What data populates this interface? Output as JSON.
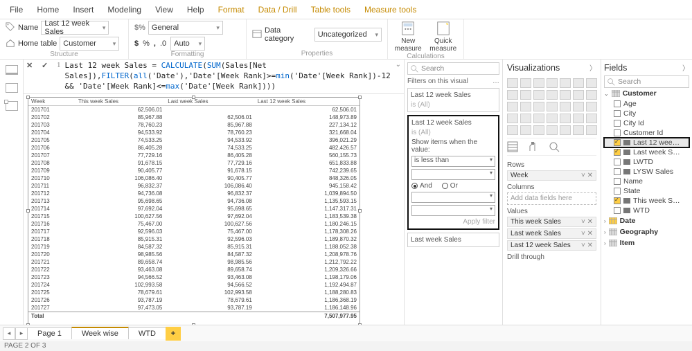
{
  "menu": [
    "File",
    "Home",
    "Insert",
    "Modeling",
    "View",
    "Help",
    "Format",
    "Data / Drill",
    "Table tools",
    "Measure tools"
  ],
  "menu_orange_from": 6,
  "ribbon": {
    "structure": {
      "name_label": "Name",
      "name_value": "Last 12 week Sales",
      "home_label": "Home table",
      "home_value": "Customer",
      "group": "Structure"
    },
    "formatting": {
      "currency": "$",
      "format_value": "General",
      "auto": "Auto",
      "group": "Formatting"
    },
    "properties": {
      "cat_label": "Data category",
      "cat_value": "Uncategorized",
      "group": "Properties"
    },
    "calc": {
      "new": "New measure",
      "quick": "Quick measure",
      "group": "Calculations"
    }
  },
  "formula": {
    "line_no": "1",
    "text": "Last 12 week Sales = CALCULATE(SUM(Sales[Net Sales]),FILTER(all('Date'),'Date'[Week Rank]>=min('Date'[Week Rank])-12 && 'Date'[Week Rank]<=max('Date'[Week Rank])))"
  },
  "table": {
    "headers": [
      "Week",
      "This week Sales",
      "Last week Sales",
      "Last 12 week Sales"
    ],
    "rows": [
      [
        "201701",
        "62,506.01",
        "",
        "62,506.01"
      ],
      [
        "201702",
        "85,967.88",
        "62,506.01",
        "148,973.89"
      ],
      [
        "201703",
        "78,760.23",
        "85,967.88",
        "227,134.12"
      ],
      [
        "201704",
        "94,533.92",
        "78,760.23",
        "321,668.04"
      ],
      [
        "201705",
        "74,533.25",
        "94,533.92",
        "396,021.29"
      ],
      [
        "201706",
        "86,405.28",
        "74,533.25",
        "482,426.57"
      ],
      [
        "201707",
        "77,729.16",
        "86,405.28",
        "560,155.73"
      ],
      [
        "201708",
        "91,678.15",
        "77,729.16",
        "651,833.88"
      ],
      [
        "201709",
        "90,405.77",
        "91,678.15",
        "742,239.65"
      ],
      [
        "201710",
        "106,086.40",
        "90,405.77",
        "848,326.05"
      ],
      [
        "201711",
        "96,832.37",
        "106,086.40",
        "945,158.42"
      ],
      [
        "201712",
        "94,736.08",
        "96,832.37",
        "1,039,894.50"
      ],
      [
        "201713",
        "95,698.65",
        "94,736.08",
        "1,135,593.15"
      ],
      [
        "201714",
        "97,692.04",
        "95,698.65",
        "1,147,317.31"
      ],
      [
        "201715",
        "100,627.56",
        "97,692.04",
        "1,183,539.38"
      ],
      [
        "201716",
        "75,467.00",
        "100,627.56",
        "1,180,246.15"
      ],
      [
        "201717",
        "92,596.03",
        "75,467.00",
        "1,178,308.26"
      ],
      [
        "201718",
        "85,915.31",
        "92,596.03",
        "1,189,870.32"
      ],
      [
        "201719",
        "84,587.32",
        "85,915.31",
        "1,188,052.38"
      ],
      [
        "201720",
        "98,985.56",
        "84,587.32",
        "1,208,978.76"
      ],
      [
        "201721",
        "89,658.74",
        "98,985.56",
        "1,212,792.22"
      ],
      [
        "201722",
        "93,463.08",
        "89,658.74",
        "1,209,326.66"
      ],
      [
        "201723",
        "94,566.52",
        "93,463.08",
        "1,198,179.06"
      ],
      [
        "201724",
        "102,993.58",
        "94,566.52",
        "1,192,494.87"
      ],
      [
        "201725",
        "78,679.61",
        "102,993.58",
        "1,188,280.83"
      ],
      [
        "201726",
        "93,787.19",
        "78,679.61",
        "1,186,368.19"
      ],
      [
        "201727",
        "97,473.05",
        "93,787.19",
        "1,186,148.96"
      ]
    ],
    "total": [
      "Total",
      "",
      "",
      "7,507,977.95"
    ]
  },
  "filters": {
    "search": "Search",
    "section": "Filters on this visual",
    "cards": [
      {
        "title": "Last 12 week Sales",
        "sub": "is (All)"
      }
    ],
    "boxed": {
      "title": "Last 12 week Sales",
      "sub": "is (All)",
      "show_label": "Show items when the value:",
      "op": "is less than",
      "and": "And",
      "or": "Or",
      "apply": "Apply filter"
    },
    "below": {
      "title": "Last week Sales"
    }
  },
  "viz": {
    "title": "Visualizations",
    "rows": "Rows",
    "rows_val": "Week",
    "cols": "Columns",
    "cols_ph": "Add data fields here",
    "vals": "Values",
    "vals_items": [
      "This week Sales",
      "Last week Sales",
      "Last 12 week Sales"
    ],
    "drill": "Drill through"
  },
  "fields": {
    "title": "Fields",
    "search": "Search",
    "tables": [
      {
        "name": "Customer",
        "expanded": true,
        "fields": [
          {
            "name": "Age",
            "checked": false
          },
          {
            "name": "City",
            "checked": false
          },
          {
            "name": "City Id",
            "checked": false
          },
          {
            "name": "Customer Id",
            "checked": false
          },
          {
            "name": "Last 12 wee…",
            "checked": true,
            "measure": true,
            "selected": true
          },
          {
            "name": "Last week S…",
            "checked": true,
            "measure": true
          },
          {
            "name": "LWTD",
            "checked": false,
            "measure": true
          },
          {
            "name": "LYSW Sales",
            "checked": false,
            "measure": true
          },
          {
            "name": "Name",
            "checked": false
          },
          {
            "name": "State",
            "checked": false
          },
          {
            "name": "This week S…",
            "checked": true,
            "measure": true
          },
          {
            "name": "WTD",
            "checked": false,
            "measure": true
          }
        ]
      },
      {
        "name": "Date",
        "expanded": false,
        "checked": true
      },
      {
        "name": "Geography",
        "expanded": false
      },
      {
        "name": "Item",
        "expanded": false
      }
    ]
  },
  "tabs": {
    "pages": [
      "Page 1",
      "Week wise",
      "WTD"
    ],
    "active": 1
  },
  "status": "PAGE 2 OF 3"
}
